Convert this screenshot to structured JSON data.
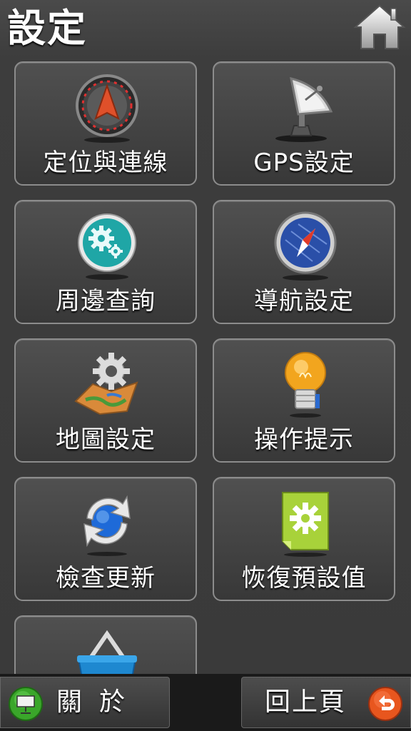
{
  "header": {
    "title": "設定",
    "home_icon": "home-icon"
  },
  "menu": {
    "items": [
      {
        "label": "定位與連線",
        "icon": "compass-locator-icon"
      },
      {
        "label": "GPS設定",
        "icon": "satellite-dish-icon"
      },
      {
        "label": "周邊查詢",
        "icon": "gear-teal-icon"
      },
      {
        "label": "導航設定",
        "icon": "compass-icon"
      },
      {
        "label": "地圖設定",
        "icon": "map-gear-icon"
      },
      {
        "label": "操作提示",
        "icon": "light-bulb-icon"
      },
      {
        "label": "檢查更新",
        "icon": "refresh-icon"
      },
      {
        "label": "恢復預設值",
        "icon": "reset-settings-icon"
      },
      {
        "label": "",
        "icon": "basket-icon"
      }
    ]
  },
  "bottom_bar": {
    "about_label": "關於",
    "about_icon": "presentation-icon",
    "back_label": "回上頁",
    "back_icon": "back-arrow-icon"
  },
  "colors": {
    "background": "#3a3a3a",
    "tile_border": "#8c8c8c",
    "back_icon": "#e8561e",
    "about_icon": "#3aa62a"
  }
}
